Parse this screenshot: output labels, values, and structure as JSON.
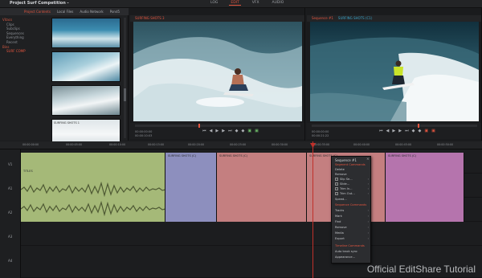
{
  "app": {
    "title": "Project Surf Competition -"
  },
  "nav": {
    "tabs": [
      {
        "label": "LOG",
        "active": false
      },
      {
        "label": "EDIT",
        "active": true
      },
      {
        "label": "VFX",
        "active": false
      },
      {
        "label": "AUDIO",
        "active": false
      }
    ]
  },
  "project_panel": {
    "tabs": [
      "Project Contents",
      "Local Files",
      "Audio Network",
      "Pond5"
    ],
    "tree": [
      {
        "label": "Vitacs",
        "level": 0
      },
      {
        "label": "Clips",
        "level": 1
      },
      {
        "label": "Subclips",
        "level": 1
      },
      {
        "label": "Sequences",
        "level": 1
      },
      {
        "label": "Everything",
        "level": 1
      },
      {
        "label": "Recent",
        "level": 1
      },
      {
        "label": "Bins",
        "level": 0
      },
      {
        "label": "SURF COMP",
        "level": 1
      }
    ],
    "thumbnails": [
      {
        "label": ""
      },
      {
        "label": ""
      },
      {
        "label": ""
      },
      {
        "label": "SURFING SHOTS 1"
      }
    ]
  },
  "source_viewer": {
    "title": "SURFING SHOTS 3",
    "timecode_in": "00:00:00:00",
    "timecode_out": "00:00:10:03"
  },
  "record_viewer": {
    "title": "Sequence #1",
    "subtitle": "SURFING SHOTS (C1)",
    "timecode_in": "00:00:00:00",
    "timecode_out": "00:00:21:22"
  },
  "timeline": {
    "ruler_ticks": [
      {
        "label": "00:00:00:00"
      },
      {
        "label": "00:00:05:00"
      },
      {
        "label": "00:00:10:00"
      },
      {
        "label": "00:00:15:00"
      },
      {
        "label": "00:00:20:00"
      },
      {
        "label": "00:00:25:00"
      },
      {
        "label": "00:00:30:00"
      },
      {
        "label": "00:00:35:00"
      },
      {
        "label": "00:00:40:00"
      },
      {
        "label": "00:00:45:00"
      },
      {
        "label": "00:00:50:00"
      }
    ],
    "tracks": [
      "V1",
      "A1",
      "A2",
      "A3",
      "A4"
    ],
    "clips": [
      {
        "label": "TITLES",
        "color": "#a5b978"
      },
      {
        "label": "SURFING SHOTS (C)",
        "color": "#8d8fbe"
      },
      {
        "label": "SURFING SHOTS (C)",
        "color": "#c47f80"
      },
      {
        "label": "SURFING SHOTS (C)",
        "color": "#c47f80"
      },
      {
        "label": "SURFING SHOTS (C)",
        "color": "#b574ad"
      }
    ]
  },
  "context_menu": {
    "title": "Sequence #1",
    "items": [
      {
        "label": "Segment Commands",
        "type": "section"
      },
      {
        "label": "Delete",
        "type": "item"
      },
      {
        "label": "Remove",
        "type": "item"
      },
      {
        "label": "Slip Se...",
        "type": "check",
        "submenu": true
      },
      {
        "label": "Slide...",
        "type": "check",
        "submenu": true
      },
      {
        "label": "Trim In...",
        "type": "check",
        "submenu": true
      },
      {
        "label": "Trim Out...",
        "type": "check",
        "submenu": true
      },
      {
        "label": "Speed...",
        "type": "item"
      },
      {
        "label": "Sequence Commands",
        "type": "section"
      },
      {
        "label": "Tracks",
        "type": "item",
        "submenu": true
      },
      {
        "label": "Mark",
        "type": "item",
        "submenu": true
      },
      {
        "label": "Find",
        "type": "item",
        "submenu": true
      },
      {
        "label": "Remove",
        "type": "item",
        "submenu": true
      },
      {
        "label": "Media",
        "type": "item",
        "submenu": true
      },
      {
        "label": "Export",
        "type": "item",
        "submenu": true
      },
      {
        "label": "Timeline Commands",
        "type": "section"
      },
      {
        "label": "Auto track sync",
        "type": "item"
      },
      {
        "label": "Appearance...",
        "type": "item"
      }
    ]
  },
  "watermark": "Official EditShare Tutorial",
  "colors": {
    "accent": "#e4553f",
    "blue": "#3ba3c7"
  }
}
